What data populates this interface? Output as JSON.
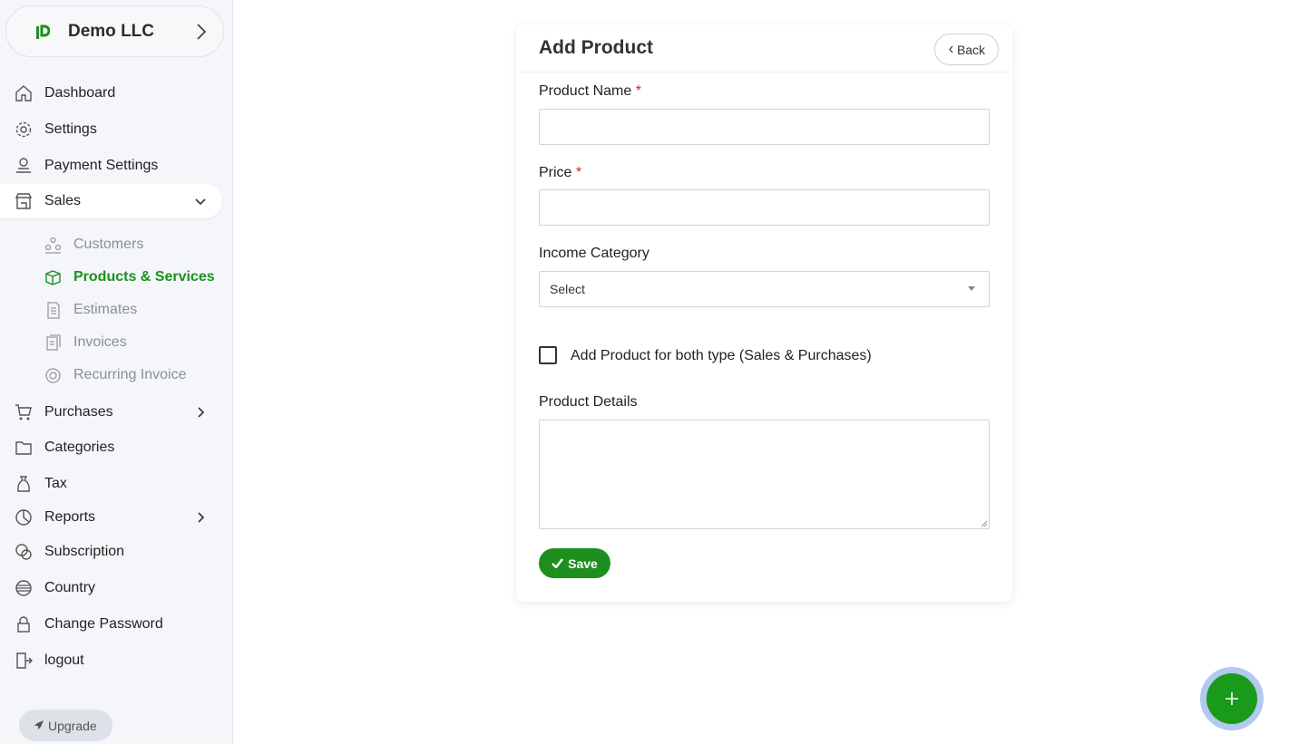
{
  "sidebar": {
    "company_name": "Demo LLC",
    "items": [
      {
        "label": "Dashboard",
        "icon": "home-icon"
      },
      {
        "label": "Settings",
        "icon": "gear-icon"
      },
      {
        "label": "Payment Settings",
        "icon": "money-hand-icon"
      },
      {
        "label": "Sales",
        "icon": "shop-icon",
        "expanded": true
      },
      {
        "label": "Purchases",
        "icon": "cart-icon"
      },
      {
        "label": "Categories",
        "icon": "folder-icon"
      },
      {
        "label": "Tax",
        "icon": "money-bag-icon"
      },
      {
        "label": "Reports",
        "icon": "pie-chart-icon"
      },
      {
        "label": "Subscription",
        "icon": "coins-icon"
      },
      {
        "label": "Country",
        "icon": "globe-icon"
      },
      {
        "label": "Change Password",
        "icon": "lock-icon"
      },
      {
        "label": "logout",
        "icon": "logout-icon"
      }
    ],
    "sales_sub": [
      {
        "label": "Customers",
        "icon": "people-icon"
      },
      {
        "label": "Products & Services",
        "icon": "box-icon",
        "active": true
      },
      {
        "label": "Estimates",
        "icon": "document-icon"
      },
      {
        "label": "Invoices",
        "icon": "invoice-icon"
      },
      {
        "label": "Recurring Invoice",
        "icon": "recurring-icon"
      }
    ],
    "upgrade_label": "Upgrade"
  },
  "form": {
    "title": "Add Product",
    "back_label": "Back",
    "product_name_label": "Product Name",
    "product_name_value": "",
    "price_label": "Price",
    "price_value": "",
    "required_mark": "*",
    "income_category_label": "Income Category",
    "income_category_selected": "Select",
    "both_type_label": "Add Product for both type (Sales & Purchases)",
    "both_type_checked": false,
    "product_details_label": "Product Details",
    "product_details_value": "",
    "save_label": "Save"
  },
  "colors": {
    "accent": "#1e8f1e",
    "required": "#dd2222",
    "sidebar_bg": "#f4f6f9"
  }
}
